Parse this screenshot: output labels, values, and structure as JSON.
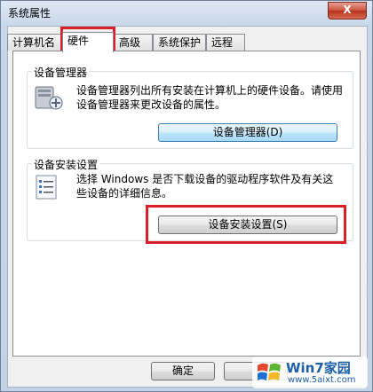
{
  "window": {
    "title": "系统属性",
    "close_label": "X"
  },
  "tabs": [
    {
      "label": "计算机名"
    },
    {
      "label": "硬件",
      "active": true
    },
    {
      "label": "高级"
    },
    {
      "label": "系统保护"
    },
    {
      "label": "远程"
    }
  ],
  "device_manager": {
    "title": "设备管理器",
    "description": "设备管理器列出所有安装在计算机上的硬件设备。请使用设备管理器来更改设备的属性。",
    "button_label": "设备管理器(D)"
  },
  "device_install": {
    "title": "设备安装设置",
    "description": "选择 Windows 是否下载设备的驱动程序软件及有关这些设备的详细信息。",
    "button_label": "设备安装设置(S)"
  },
  "footer": {
    "ok_label": "确定"
  },
  "watermark": {
    "text": "Win7家园",
    "url": "www.5aixt.com"
  },
  "colors": {
    "highlight": "#d9202a",
    "focus_border": "#3c7fb1"
  }
}
